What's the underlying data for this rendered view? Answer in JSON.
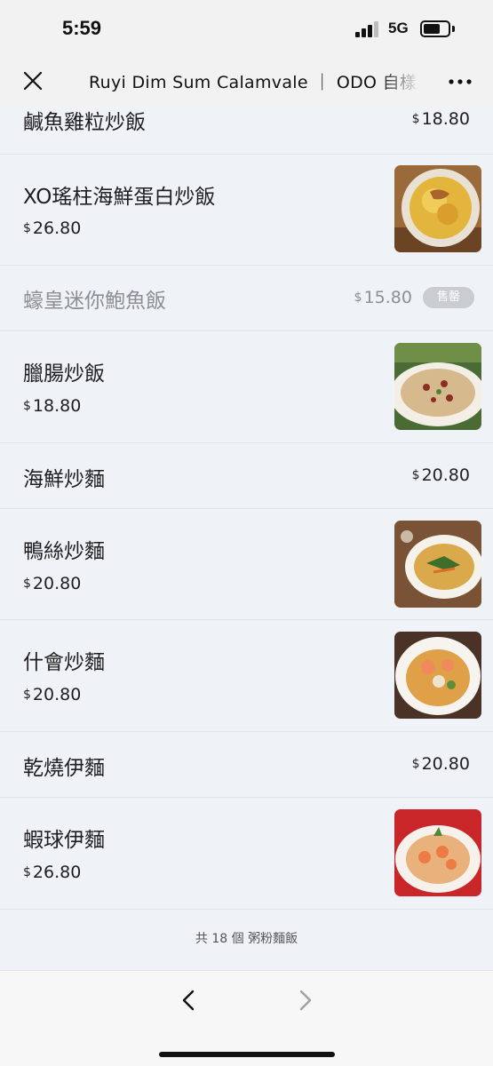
{
  "status_bar": {
    "time": "5:59",
    "network": "5G"
  },
  "nav": {
    "title": "Ruyi Dim Sum Calamvale ｜ ODO 自樣"
  },
  "currency_symbol": "$",
  "menu": [
    {
      "name": "鹹魚雞粒炒飯",
      "price": "18.80"
    },
    {
      "name": "XO瑤柱海鮮蛋白炒飯",
      "price": "26.80",
      "image": "fried-rice-golden-photo"
    },
    {
      "name": "蠔皇迷你鮑魚飯",
      "price": "15.80",
      "badge": "售罄"
    },
    {
      "name": "臘腸炒飯",
      "price": "18.80",
      "image": "sausage-fried-rice-photo"
    },
    {
      "name": "海鮮炒麵",
      "price": "20.80"
    },
    {
      "name": "鴨絲炒麵",
      "price": "20.80",
      "image": "duck-noodles-photo"
    },
    {
      "name": "什會炒麵",
      "price": "20.80",
      "image": "combination-noodles-photo"
    },
    {
      "name": "乾燒伊麵",
      "price": "20.80"
    },
    {
      "name": "蝦球伊麵",
      "price": "26.80",
      "image": "prawn-noodles-photo"
    }
  ],
  "footer": {
    "total_text": "共 18 個 粥粉麵飯"
  },
  "colors": {
    "background": "#eff2f7",
    "soldout_badge": "#c9ccd1",
    "text": "#1f1f1f"
  }
}
